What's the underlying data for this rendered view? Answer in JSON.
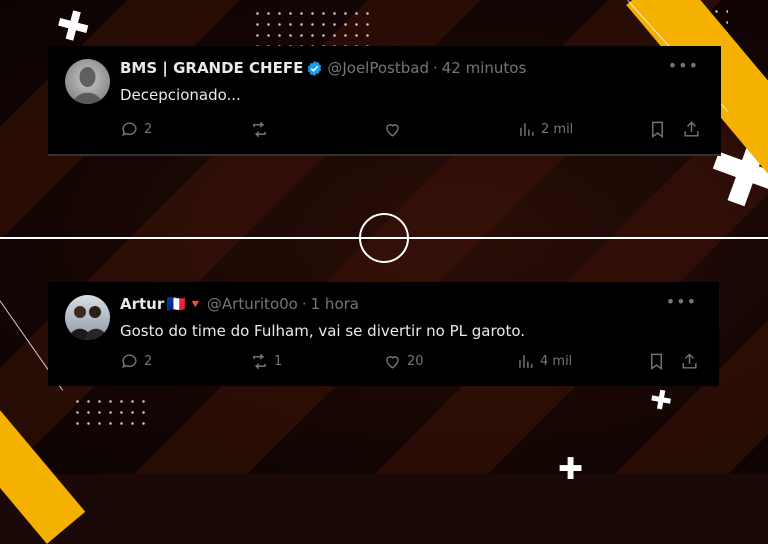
{
  "tweets": [
    {
      "display_name": "BMS | GRANDE CHEFE",
      "verified": true,
      "handle": "@JoelPostbad",
      "separator": "·",
      "time": "42 minutos",
      "text": "Decepcionado...",
      "replies": "2",
      "retweets": "",
      "likes": "",
      "views": "2 mil"
    },
    {
      "display_name": "Artur",
      "flag": "🇫🇷",
      "badge": "🔻",
      "handle": "@Arturito0o",
      "separator": "·",
      "time": "1 hora",
      "text": "Gosto do time do Fulham, vai se divertir no PL garoto.",
      "replies": "2",
      "retweets": "1",
      "likes": "20",
      "views": "4 mil"
    }
  ],
  "more_label": "•••",
  "colors": {
    "accent_yellow": "#f5b100",
    "verified_blue": "#1d9bf0",
    "muted": "#71767b",
    "tweet_bg": "#000000"
  },
  "icons": [
    "reply-icon",
    "retweet-icon",
    "like-icon",
    "views-icon",
    "bookmark-icon",
    "share-icon",
    "verified-icon",
    "more-icon"
  ]
}
